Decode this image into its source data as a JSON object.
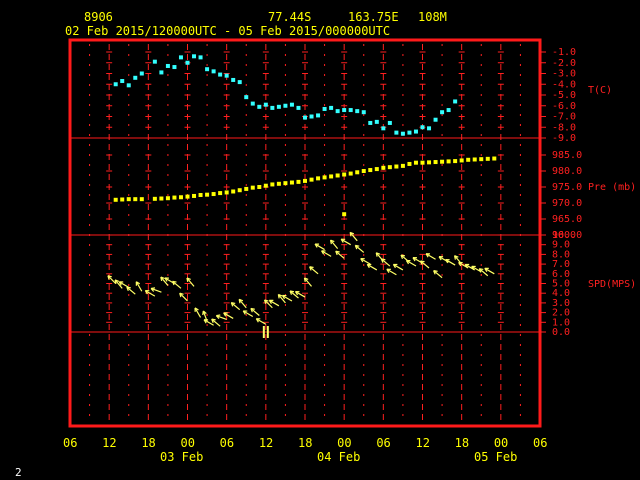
{
  "header": {
    "station": "8906",
    "lat": "77.44S",
    "lon": "163.75E",
    "elev": "108M",
    "period": "02 Feb 2015/120000UTC - 05 Feb 2015/000000UTC"
  },
  "footer": {
    "page": "2"
  },
  "colors": {
    "frame": "#ff1a1a",
    "temp": "#33ffff",
    "pres": "#ffff00",
    "wind": "#ffff66",
    "axis": "#ff2020",
    "text": "#ffff00"
  },
  "chart_data": [
    {
      "type": "scatter",
      "name": "temperature",
      "ylabel": "T(C)",
      "ylim": [
        -9.0,
        -1.0
      ],
      "yticks": [
        "-1.0",
        "-2.0",
        "-3.0",
        "-4.0",
        "-5.0",
        "-6.0",
        "-7.0",
        "-8.0",
        "-9.0"
      ],
      "x": [
        13,
        14,
        15,
        16,
        17,
        19,
        20,
        21,
        22,
        23,
        24,
        25,
        26,
        27,
        28,
        29,
        30,
        31,
        32,
        33,
        34,
        35,
        36,
        37,
        38,
        39,
        40,
        41,
        42,
        43,
        44,
        45,
        46,
        47,
        48,
        49,
        50,
        51,
        52,
        53,
        54,
        55,
        56,
        57,
        58,
        59,
        60,
        61,
        62,
        63,
        64,
        65,
        66,
        67,
        68,
        69,
        70,
        71
      ],
      "values": [
        -4.0,
        -3.7,
        -4.1,
        -3.4,
        -3.0,
        -1.9,
        -2.9,
        -2.3,
        -2.4,
        -1.5,
        -2.0,
        -1.4,
        -1.5,
        -2.6,
        -2.8,
        -3.1,
        -3.2,
        -3.6,
        -3.8,
        -5.2,
        -5.8,
        -6.1,
        -5.9,
        -6.2,
        -6.1,
        -6.0,
        -5.9,
        -6.2,
        -7.1,
        -7.0,
        -6.9,
        -6.3,
        -6.2,
        -6.5,
        -6.4,
        -6.4,
        -6.5,
        -6.6,
        -7.6,
        -7.5,
        -8.1,
        -7.6,
        -8.5,
        -8.6,
        -8.5,
        -8.4,
        -8.0,
        -8.1,
        -7.3,
        -6.6,
        -6.4,
        -5.6
      ],
      "grid": true
    },
    {
      "type": "scatter",
      "name": "pressure",
      "ylabel": "Pre (mb)",
      "ylim": [
        960.0,
        985.0
      ],
      "yticks": [
        "985.0",
        "980.0",
        "975.0",
        "970.0",
        "965.0",
        "960.0"
      ],
      "x": [
        13,
        14,
        15,
        16,
        17,
        19,
        20,
        21,
        22,
        23,
        24,
        25,
        26,
        27,
        28,
        29,
        30,
        31,
        32,
        33,
        34,
        35,
        36,
        37,
        38,
        39,
        40,
        41,
        42,
        43,
        44,
        45,
        46,
        47,
        48,
        49,
        50,
        51,
        52,
        53,
        54,
        55,
        56,
        57,
        58,
        59,
        60,
        61,
        62,
        63,
        64,
        65,
        66,
        67,
        68,
        69,
        70,
        71
      ],
      "values": [
        971.0,
        971.1,
        971.2,
        971.2,
        971.2,
        971.3,
        971.4,
        971.5,
        971.7,
        971.8,
        972.0,
        972.2,
        972.5,
        972.6,
        972.8,
        973.1,
        973.3,
        973.6,
        974.0,
        974.4,
        974.8,
        975.0,
        975.4,
        975.8,
        976.0,
        976.2,
        976.4,
        976.6,
        976.9,
        977.3,
        977.7,
        978.0,
        978.3,
        978.6,
        978.9,
        979.2,
        979.6,
        980.0,
        980.3,
        980.6,
        981.0,
        981.2,
        981.4,
        981.6,
        982.2,
        982.6,
        982.6,
        982.7,
        982.8,
        982.9,
        983.0,
        983.1,
        983.3,
        983.5,
        983.6,
        983.7,
        983.8,
        983.9
      ],
      "outliers": [
        {
          "x": 48,
          "value": 966.5
        }
      ],
      "grid": true
    },
    {
      "type": "scatter",
      "name": "wind",
      "ylabel": "SPD(MPS)",
      "ylim": [
        0.0,
        10.0
      ],
      "yticks": [
        "10.0",
        "9.0",
        "8.0",
        "7.0",
        "6.0",
        "5.0",
        "4.0",
        "3.0",
        "2.0",
        "1.0",
        "0.0"
      ],
      "x": [
        13,
        14,
        15,
        16,
        17,
        19,
        20,
        21,
        22,
        23,
        24,
        25,
        26,
        27,
        28,
        29,
        30,
        31,
        32,
        33,
        34,
        35,
        36,
        37,
        38,
        39,
        40,
        41,
        42,
        43,
        44,
        45,
        46,
        47,
        48,
        49,
        50,
        51,
        52,
        53,
        54,
        55,
        56,
        57,
        58,
        59,
        60,
        61,
        62,
        63,
        64,
        65,
        66,
        67,
        68,
        69,
        70,
        71
      ],
      "values": [
        5.0,
        4.5,
        4.6,
        3.9,
        4.2,
        3.7,
        4.1,
        4.8,
        5.0,
        4.5,
        3.2,
        4.7,
        1.5,
        1.1,
        0.7,
        0.6,
        1.3,
        1.4,
        2.3,
        2.5,
        1.6,
        1.7,
        0.8,
        2.5,
        2.7,
        3.0,
        3.2,
        3.5,
        3.6,
        4.7,
        6.0,
        8.5,
        7.8,
        8.6,
        7.6,
        9.0,
        9.4,
        8.2,
        7.0,
        6.4,
        7.3,
        6.8,
        5.9,
        6.4,
        7.2,
        6.8,
        7.1,
        6.6,
        7.5,
        5.6,
        7.2,
        6.9,
        7.0,
        6.6,
        6.4,
        6.2,
        5.8,
        6.0
      ],
      "direction_deg": [
        315,
        320,
        300,
        310,
        330,
        300,
        290,
        320,
        300,
        310,
        315,
        320,
        330,
        340,
        300,
        310,
        290,
        300,
        310,
        320,
        300,
        310,
        300,
        315,
        300,
        320,
        300,
        310,
        300,
        320,
        310,
        300,
        300,
        320,
        310,
        300,
        320,
        310,
        300,
        300,
        320,
        310,
        300,
        300,
        310,
        300,
        300,
        310,
        300,
        310,
        300,
        300,
        320,
        300,
        300,
        300,
        310,
        300
      ],
      "grid": true
    }
  ],
  "xaxis": {
    "hour_labels": [
      "06",
      "12",
      "18",
      "00",
      "06",
      "12",
      "18",
      "00",
      "06",
      "12",
      "18",
      "00",
      "06"
    ],
    "day_labels": [
      "03 Feb",
      "04 Feb",
      "05 Feb"
    ],
    "range": [
      6,
      78
    ]
  }
}
